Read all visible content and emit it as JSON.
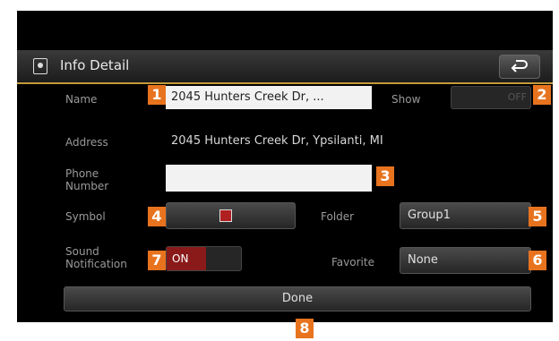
{
  "header": {
    "title": "Info Detail"
  },
  "form": {
    "name_label": "Name",
    "name_value": "2045 Hunters Creek Dr, ...",
    "show_label": "Show",
    "show_toggle": "OFF",
    "address_label": "Address",
    "address_value": "2045 Hunters Creek Dr, Ypsilanti, MI",
    "phone_label_line1": "Phone",
    "phone_label_line2": "Number",
    "phone_value": "",
    "symbol_label": "Symbol",
    "folder_label": "Folder",
    "folder_value": "Group1",
    "sound_label_line1": "Sound",
    "sound_label_line2": "Notification",
    "sound_toggle": "ON",
    "favorite_label": "Favorite",
    "favorite_value": "None",
    "done_label": "Done"
  },
  "callouts": [
    "1",
    "2",
    "3",
    "4",
    "5",
    "6",
    "7",
    "8"
  ],
  "colors": {
    "accent": "#e8731e",
    "divider": "#c49a3a",
    "toggle_on": "#8a1a1a"
  }
}
